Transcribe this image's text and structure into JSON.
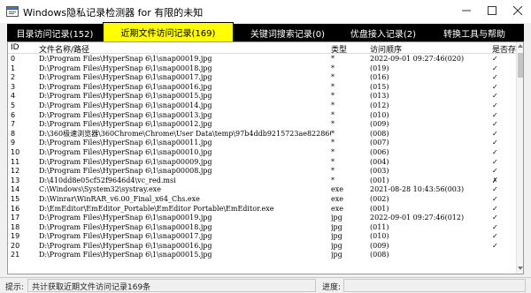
{
  "window": {
    "title": "Windows隐私记录检测器  for 有限的未知"
  },
  "tabs": [
    {
      "label": "目录访问记录(152)",
      "active": false
    },
    {
      "label": "近期文件访问记录(169)",
      "active": true
    },
    {
      "label": "关键词搜索记录(0)",
      "active": false
    },
    {
      "label": "优盘接入记录(2)",
      "active": false
    },
    {
      "label": "转换工具与帮助",
      "active": false
    }
  ],
  "table": {
    "columns": {
      "id": "ID",
      "path": "文件名称/路径",
      "type": "类型",
      "order": "访问顺序",
      "exist": "是否存在"
    },
    "rows": [
      {
        "id": "0",
        "path": "D:\\Program Files\\HyperSnap 6\\1\\snap00019.jpg",
        "type": "*",
        "order": "2022-09-01 09:27:46(020)",
        "exist": "✓"
      },
      {
        "id": "1",
        "path": "D:\\Program Files\\HyperSnap 6\\1\\snap00018.jpg",
        "type": "*",
        "order": "(019)",
        "exist": "✓"
      },
      {
        "id": "2",
        "path": "D:\\Program Files\\HyperSnap 6\\1\\snap00017.jpg",
        "type": "*",
        "order": "(016)",
        "exist": "✓"
      },
      {
        "id": "3",
        "path": "D:\\Program Files\\HyperSnap 6\\1\\snap00016.jpg",
        "type": "*",
        "order": "(015)",
        "exist": "✓"
      },
      {
        "id": "4",
        "path": "D:\\Program Files\\HyperSnap 6\\1\\snap00015.jpg",
        "type": "*",
        "order": "(013)",
        "exist": "✓"
      },
      {
        "id": "5",
        "path": "D:\\Program Files\\HyperSnap 6\\1\\snap00014.jpg",
        "type": "*",
        "order": "(012)",
        "exist": "✓"
      },
      {
        "id": "6",
        "path": "D:\\Program Files\\HyperSnap 6\\1\\snap00013.jpg",
        "type": "*",
        "order": "(010)",
        "exist": "✓"
      },
      {
        "id": "7",
        "path": "D:\\Program Files\\HyperSnap 6\\1\\snap00012.jpg",
        "type": "*",
        "order": "(009)",
        "exist": "✓"
      },
      {
        "id": "8",
        "path": "D:\\360极速浏览器\\360Chrome\\Chrome\\User Data\\temp\\97b4ddb9215723ae822860d4a...",
        "type": "*",
        "order": "(008)",
        "exist": "✓"
      },
      {
        "id": "9",
        "path": "D:\\Program Files\\HyperSnap 6\\1\\snap00011.jpg",
        "type": "*",
        "order": "(007)",
        "exist": "✓"
      },
      {
        "id": "10",
        "path": "D:\\Program Files\\HyperSnap 6\\1\\snap00010.jpg",
        "type": "*",
        "order": "(006)",
        "exist": "✓"
      },
      {
        "id": "11",
        "path": "D:\\Program Files\\HyperSnap 6\\1\\snap00009.jpg",
        "type": "*",
        "order": "(004)",
        "exist": "✓"
      },
      {
        "id": "12",
        "path": "D:\\Program Files\\HyperSnap 6\\1\\snap00008.jpg",
        "type": "*",
        "order": "(003)",
        "exist": "✓"
      },
      {
        "id": "13",
        "path": "D:\\410dd8e05cf52f9646d4\\vc_red.msi",
        "type": "*",
        "order": "(001)",
        "exist": "✗"
      },
      {
        "id": "14",
        "path": "C:\\Windows\\System32\\systray.exe",
        "type": "exe",
        "order": "2021-08-28 10:43:56(003)",
        "exist": "✓"
      },
      {
        "id": "15",
        "path": "D:\\Winrar\\WinRAR_v6.00_Final_x64_Chs.exe",
        "type": "exe",
        "order": "(002)",
        "exist": "✓"
      },
      {
        "id": "16",
        "path": "D:\\EmEditor\\EmEditor_Portable\\EmEditor Portable\\EmEditor.exe",
        "type": "exe",
        "order": "(001)",
        "exist": "✓"
      },
      {
        "id": "17",
        "path": "D:\\Program Files\\HyperSnap 6\\1\\snap00019.jpg",
        "type": "jpg",
        "order": "2022-09-01 09:27:46(012)",
        "exist": "✓"
      },
      {
        "id": "18",
        "path": "D:\\Program Files\\HyperSnap 6\\1\\snap00018.jpg",
        "type": "jpg",
        "order": "(011)",
        "exist": "✓"
      },
      {
        "id": "19",
        "path": "D:\\Program Files\\HyperSnap 6\\1\\snap00017.jpg",
        "type": "jpg",
        "order": "(010)",
        "exist": "✓"
      },
      {
        "id": "20",
        "path": "D:\\Program Files\\HyperSnap 6\\1\\snap00016.jpg",
        "type": "jpg",
        "order": "(009)",
        "exist": "✓"
      },
      {
        "id": "21",
        "path": "D:\\Program Files\\HyperSnap 6\\1\\snap00015.jpg",
        "type": "jpg",
        "order": "(008)",
        "exist": ""
      }
    ]
  },
  "statusbar": {
    "hint_label": "提示:",
    "hint_text": "共计获取近期文件访问记录169条",
    "progress_label": "进度:",
    "progress_fraction": 0
  },
  "colors": {
    "active_tab": "#ffff00",
    "tab_bg": "#000000",
    "tab_text": "#ffffff",
    "progress": "#06b025"
  },
  "icons": {
    "app": "app-icon",
    "minimize": "minimize-icon",
    "maximize": "maximize-icon",
    "close": "close-icon"
  }
}
